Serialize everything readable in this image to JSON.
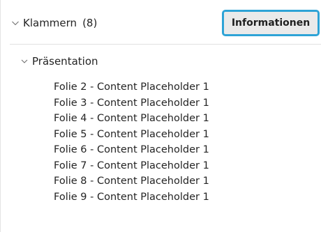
{
  "section": {
    "label": "Klammern",
    "count": "(8)",
    "button_label": "Informationen"
  },
  "group": {
    "label": "Präsentation"
  },
  "items": [
    {
      "label": "Folie 2 - Content Placeholder 1"
    },
    {
      "label": "Folie 3 - Content Placeholder 1"
    },
    {
      "label": "Folie 4 - Content Placeholder 1"
    },
    {
      "label": "Folie 5 - Content Placeholder 1"
    },
    {
      "label": "Folie 6 - Content Placeholder 1"
    },
    {
      "label": "Folie 7 - Content Placeholder 1"
    },
    {
      "label": "Folie 8 - Content Placeholder 1"
    },
    {
      "label": "Folie 9 - Content Placeholder 1"
    }
  ],
  "icons": {
    "section_toggle": "chevron-down-icon",
    "group_toggle": "chevron-down-icon"
  },
  "colors": {
    "focus_border": "#2ea3d6",
    "button_background": "#eaeaea"
  }
}
